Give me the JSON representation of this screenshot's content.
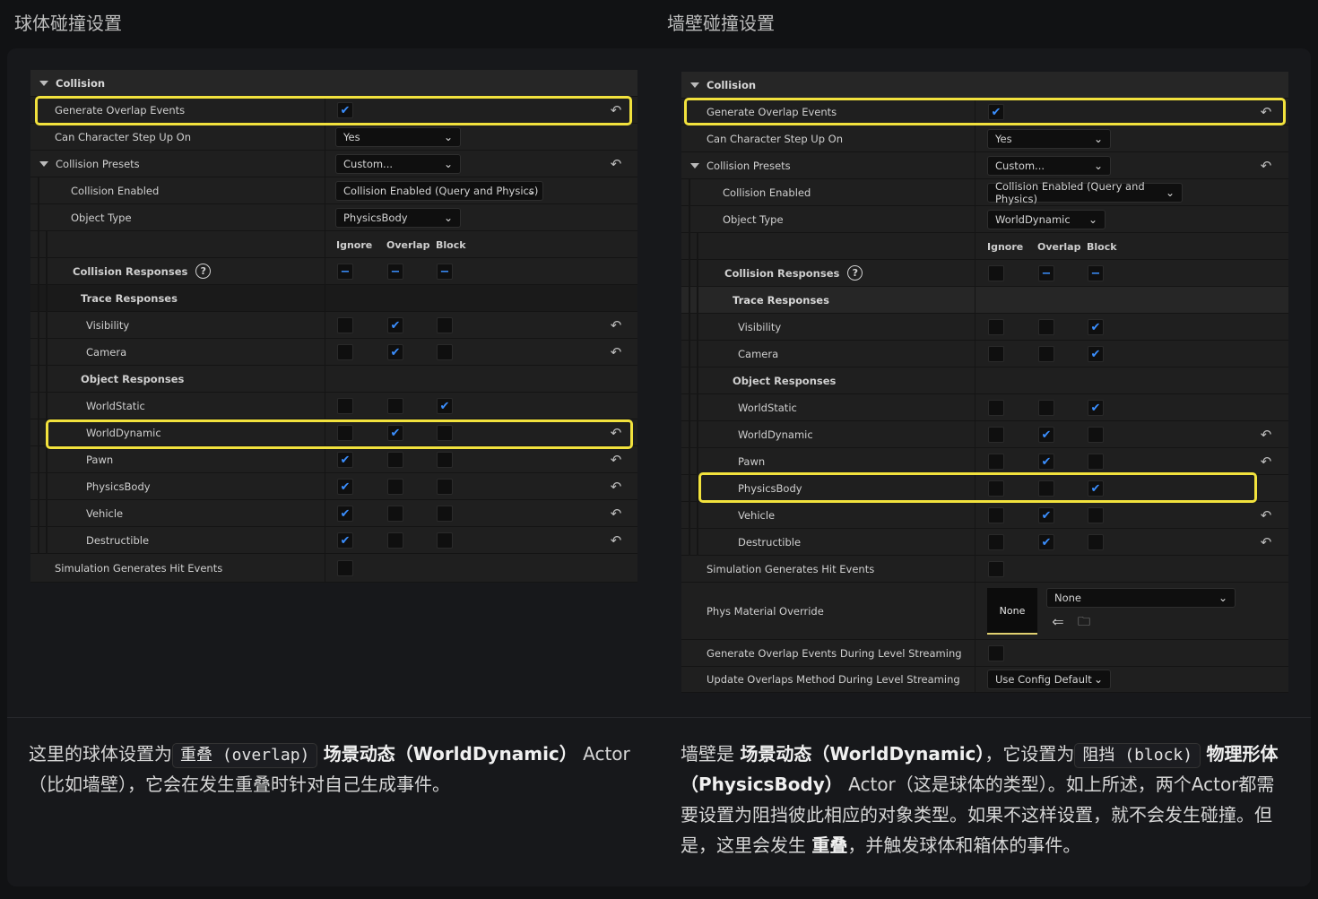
{
  "headings": {
    "left": "球体碰撞设置",
    "right": "墙壁碰撞设置"
  },
  "panel": {
    "collision": "Collision",
    "generate_overlap": "Generate Overlap Events",
    "step_up": "Can Character Step Up On",
    "presets": "Collision Presets",
    "enabled": "Collision Enabled",
    "object_type": "Object Type",
    "col_ignore": "Ignore",
    "col_overlap": "Overlap",
    "col_block": "Block",
    "responses": "Collision Responses",
    "trace": "Trace Responses",
    "visibility": "Visibility",
    "camera": "Camera",
    "object": "Object Responses",
    "worldstatic": "WorldStatic",
    "worlddynamic": "WorldDynamic",
    "pawn": "Pawn",
    "physicsbody": "PhysicsBody",
    "vehicle": "Vehicle",
    "destructible": "Destructible",
    "sim_hit": "Simulation Generates Hit Events",
    "phys_material": "Phys Material Override",
    "gen_streaming": "Generate Overlap Events During Level Streaming",
    "update_method": "Update Overlaps Method During Level Streaming"
  },
  "values": {
    "yes": "Yes",
    "custom": "Custom...",
    "enabled_value": "Collision Enabled (Query and Physics)",
    "left_object_type": "PhysicsBody",
    "right_object_type": "WorldDynamic",
    "none": "None",
    "use_config": "Use Config Default"
  },
  "states": {
    "left": {
      "generate_overlap": true,
      "responses": [
        "-",
        "-",
        "-"
      ],
      "visibility": [
        false,
        true,
        false
      ],
      "camera": [
        false,
        true,
        false
      ],
      "worldstatic": [
        false,
        false,
        true
      ],
      "worlddynamic": [
        false,
        true,
        false
      ],
      "pawn": [
        true,
        false,
        false
      ],
      "physicsbody": [
        true,
        false,
        false
      ],
      "vehicle": [
        true,
        false,
        false
      ],
      "destructible": [
        true,
        false,
        false
      ],
      "sim_hit": false
    },
    "right": {
      "generate_overlap": true,
      "responses": [
        "",
        "-",
        "-"
      ],
      "visibility": [
        false,
        false,
        true
      ],
      "camera": [
        false,
        false,
        true
      ],
      "worldstatic": [
        false,
        false,
        true
      ],
      "worlddynamic": [
        false,
        true,
        false
      ],
      "pawn": [
        false,
        true,
        false
      ],
      "physicsbody": [
        false,
        false,
        true
      ],
      "vehicle": [
        false,
        true,
        false
      ],
      "destructible": [
        false,
        true,
        false
      ],
      "sim_hit": false,
      "gen_streaming": false
    }
  },
  "desc": {
    "left_1": "这里的球体设置为",
    "left_code": "重叠 (overlap)",
    "left_2": "场景动态（WorldDynamic）",
    "left_3": "Actor",
    "left_4": "（比如墙壁），它会在发生重叠时针对自己生成事件。",
    "right_1": "墙壁是",
    "right_2": "场景动态（WorldDynamic）",
    "right_3": "，它设置为",
    "right_code": "阻挡 (block)",
    "right_4": "物理形体（PhysicsBody）",
    "right_5": "Actor（这是球体的类型）。如上所述，两个Actor都需要设置为阻挡彼此相应的对象类型。如果不这样设置，就不会发生碰撞。但是，这里会发生",
    "right_6": "重叠",
    "right_7": "，并触发球体和箱体的事件。"
  },
  "colors": {
    "accent": "#3b8fff",
    "highlight": "#f2e23d"
  },
  "icons": [
    "collapse-triangle-icon",
    "checkbox-check-icon",
    "reset-arrow-icon",
    "chevron-down-icon",
    "help-circle-icon",
    "browse-asset-icon",
    "use-selected-icon"
  ]
}
